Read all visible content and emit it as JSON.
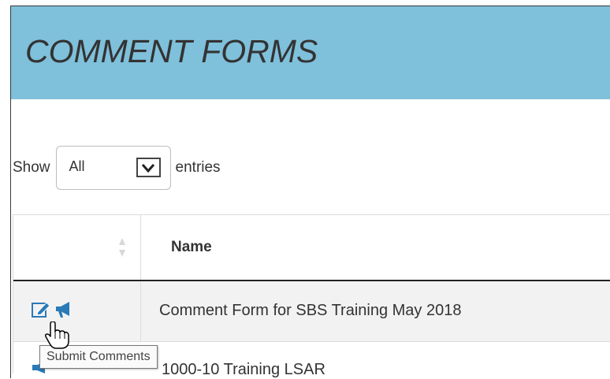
{
  "header": {
    "title": "COMMENT FORMS",
    "bg": "#7fc0db"
  },
  "length_menu": {
    "show_label": "Show",
    "selected": "All",
    "entries_label": "entries"
  },
  "table": {
    "columns": [
      "",
      "Name"
    ],
    "rows": [
      {
        "name": "Comment Form for SBS Training May 2018",
        "icons": [
          "edit-icon",
          "megaphone-icon"
        ]
      },
      {
        "name": "1000-10 Training LSAR",
        "icons": [
          "megaphone-icon"
        ]
      }
    ]
  },
  "tooltip": {
    "text": "Submit Comments"
  },
  "colors": {
    "icon_blue": "#2a7ab8",
    "row_highlight": "#f2f2f2"
  }
}
